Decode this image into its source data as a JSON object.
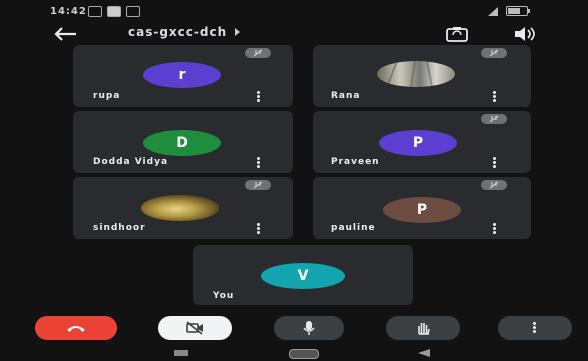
{
  "status": {
    "time": "14:42"
  },
  "meeting": {
    "code": "cas-gxcc-dch"
  },
  "participants": [
    {
      "name": "rupa",
      "initial": "r",
      "color": "#5b3fd1"
    },
    {
      "name": "Rana",
      "initial": "",
      "color": "#9a9a8a"
    },
    {
      "name": "Dodda Vidya",
      "initial": "D",
      "color": "#1e8e3e"
    },
    {
      "name": "Praveen",
      "initial": "P",
      "color": "#5b3fd1"
    },
    {
      "name": "sindhoor",
      "initial": "",
      "color": "#8a7a3a"
    },
    {
      "name": "pauline",
      "initial": "P",
      "color": "#6d4c41"
    },
    {
      "name": "You",
      "initial": "V",
      "color": "#12a4af"
    }
  ],
  "colors": {
    "end_call": "#ea4335",
    "tile_bg": "#2a2b2e",
    "app_bg": "#121212"
  },
  "icons": {
    "back": "arrow-left-icon",
    "flip": "camera-flip-icon",
    "speaker": "speaker-icon",
    "end": "phone-hangup-icon",
    "video": "video-off-icon",
    "mic": "mic-icon",
    "hand": "raise-hand-icon",
    "more": "more-vert-icon"
  }
}
